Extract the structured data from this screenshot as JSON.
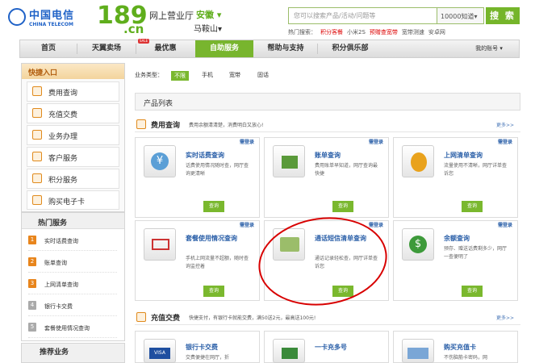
{
  "header": {
    "logo_cn": "中国电信",
    "logo_en": "CHINA TELECOM",
    "logo_number": "189",
    "logo_domain": ".cn",
    "hall_title": "网上营业厅",
    "province": "安徽 ▾",
    "city": "马鞍山▾",
    "search_placeholder": "您可以搜索产品/活动/问题等",
    "search_scope": "10000知道▾",
    "search_button": "搜 索",
    "hot_label": "热门搜索：",
    "hot_items": [
      "积分客餐",
      "小米2S",
      "预赠查宽带",
      "宽带测速",
      "安卓网"
    ]
  },
  "nav": {
    "items": [
      "首页",
      "天翼卖场",
      "最优惠",
      "自助服务",
      "帮助与支持",
      "积分俱乐部"
    ],
    "hot_badge": "SALE",
    "account": "我的账号 ▾"
  },
  "sidebar": {
    "quick_title": "快捷入口",
    "quick_items": [
      "费用查询",
      "充值交费",
      "业务办理",
      "客户服务",
      "积分服务",
      "购买电子卡"
    ],
    "hot_title": "热门服务",
    "hot_services": [
      "实时话费查询",
      "账单查询",
      "上网清单查询",
      "银行卡交费",
      "套餐使用情况查询"
    ],
    "recommend_title": "推荐业务"
  },
  "filter": {
    "label": "业务类型：",
    "options": [
      "不限",
      "手机",
      "宽带",
      "固话"
    ]
  },
  "product_list_title": "产品列表",
  "sections": {
    "fee": {
      "title": "费用查询",
      "desc": "费用余额清清楚，消费明白又放心!",
      "more": "更多>>"
    },
    "recharge": {
      "title": "充值交费",
      "desc": "快捷支付，有银行卡就能交费，满50送2元，最高送100元!",
      "more": "更多>>"
    }
  },
  "cards_row1": [
    {
      "title": "实时话费查询",
      "desc": "话费使用情况随时查，网厅查询更清晰",
      "need": "需登录",
      "btn": "查询"
    },
    {
      "title": "账单查询",
      "desc": "费用账单早知道，网厅查询最快捷",
      "need": "需登录",
      "btn": "查询"
    },
    {
      "title": "上网清单查询",
      "desc": "流量使用不清晰，网厅详单查诉您",
      "need": "需登录",
      "btn": "查询"
    }
  ],
  "cards_row2": [
    {
      "title": "套餐使用情况查询",
      "desc": "手机上网流量不超额，随时查询监控着",
      "need": "需登录",
      "btn": "查询"
    },
    {
      "title": "通话短信清单查询",
      "desc": "通话记录轻松查，网厅详单查诉您",
      "need": "需登录",
      "btn": "查询"
    },
    {
      "title": "余额查询",
      "desc": "预存、赠送话费剩多少，网厅一查便明了",
      "need": "需登录",
      "btn": "查询"
    }
  ],
  "cards_row3": [
    {
      "title": "银行卡交费",
      "desc": "交费便捷在网厅，折"
    },
    {
      "title": "一卡充多号",
      "desc": ""
    },
    {
      "title": "购买充值卡",
      "desc": "不伤脑筋卡密码，网"
    }
  ],
  "colors": {
    "brand_green": "#7ab82e",
    "brand_blue": "#1f62c7",
    "annotation_red": "#d80000"
  }
}
